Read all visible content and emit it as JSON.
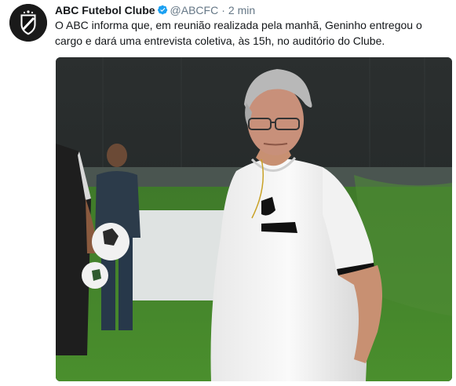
{
  "tweet": {
    "display_name": "ABC Futebol Clube",
    "handle": "@ABCFC",
    "separator": "·",
    "time": "2 min",
    "text": "O ABC informa que, em reunião realizada pela manhã, Geninho entregou o cargo e dará uma entrevista coletiva, às 15h, no auditório do Clube.",
    "avatar_icon": "club-crest-icon",
    "verified_icon": "verified-badge-icon"
  },
  "colors": {
    "verified_blue": "#1da1f2",
    "text_primary": "#14171a",
    "text_secondary": "#657786",
    "avatar_bg": "#1a1a1a"
  }
}
